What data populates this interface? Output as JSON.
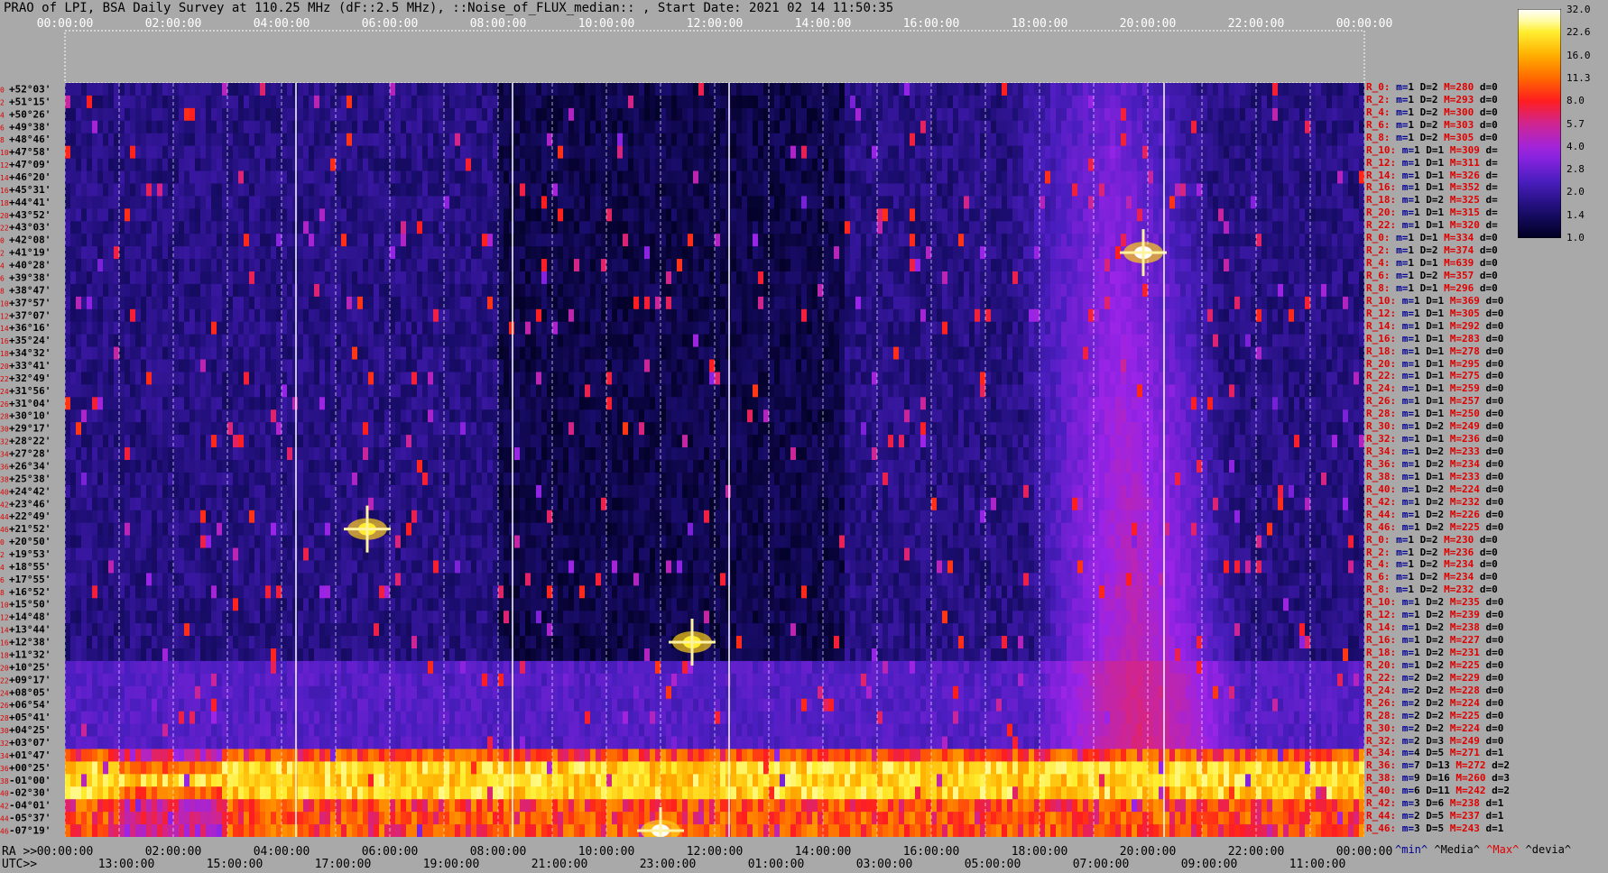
{
  "title": "PRAO of LPI, BSA Daily Survey at 110.25 MHz (dF::2.5 MHz), ::Noise_of_FLUX_median:: , Start Date: 2021 02 14 11:50:35",
  "chart_data": {
    "type": "heatmap",
    "title": "PRAO of LPI, BSA Daily Survey at 110.25 MHz (dF::2.5 MHz), ::Noise_of_FLUX_median:: , Start Date: 2021 02 14 11:50:35",
    "x_top_ticks": [
      "00:00:00",
      "02:00:00",
      "04:00:00",
      "06:00:00",
      "08:00:00",
      "10:00:00",
      "12:00:00",
      "14:00:00",
      "16:00:00",
      "18:00:00",
      "20:00:00",
      "22:00:00",
      "00:00:00"
    ],
    "x_bottom_ra_prefix": "RA >>",
    "x_bottom_ra_ticks": [
      "00:00:00",
      "02:00:00",
      "04:00:00",
      "06:00:00",
      "08:00:00",
      "10:00:00",
      "12:00:00",
      "14:00:00",
      "16:00:00",
      "18:00:00",
      "20:00:00",
      "22:00:00",
      "00:00:00"
    ],
    "x_bottom_utc_prefix": "UTC>>",
    "x_bottom_utc_ticks": [
      "13:00:00",
      "15:00:00",
      "17:00:00",
      "19:00:00",
      "21:00:00",
      "23:00:00",
      "01:00:00",
      "03:00:00",
      "05:00:00",
      "07:00:00",
      "09:00:00",
      "11:00:00"
    ],
    "y_dec_labels": [
      "+52°03'",
      "+51°15'",
      "+50°26'",
      "+49°38'",
      "+48°46'",
      "+47°58'",
      "+47°09'",
      "+46°20'",
      "+45°31'",
      "+44°41'",
      "+43°52'",
      "+43°03'",
      "+42°08'",
      "+41°19'",
      "+40°28'",
      "+39°38'",
      "+38°47'",
      "+37°57'",
      "+37°07'",
      "+36°16'",
      "+35°24'",
      "+34°32'",
      "+33°41'",
      "+32°49'",
      "+31°56'",
      "+31°04'",
      "+30°10'",
      "+29°17'",
      "+28°22'",
      "+27°28'",
      "+26°34'",
      "+25°38'",
      "+24°42'",
      "+23°46'",
      "+22°49'",
      "+21°52'",
      "+20°50'",
      "+19°53'",
      "+18°55'",
      "+17°55'",
      "+16°52'",
      "+15°50'",
      "+14°48'",
      "+13°44'",
      "+12°38'",
      "+11°32'",
      "+10°25'",
      "+09°17'",
      "+08°05'",
      "+06°54'",
      "+05°41'",
      "+04°25'",
      "+03°07'",
      "+01°47'",
      "+00°25'",
      "-01°00'",
      "-02°30'",
      "-04°01'",
      "-05°37'",
      "-07°19'"
    ],
    "y_beam_labels": [
      "0",
      "2",
      "4",
      "6",
      "8",
      "10",
      "12",
      "14",
      "16",
      "18",
      "20",
      "22",
      "0",
      "2",
      "4",
      "6",
      "8",
      "10",
      "12",
      "14",
      "16",
      "18",
      "20",
      "22",
      "24",
      "26",
      "28",
      "30",
      "32",
      "34",
      "36",
      "38",
      "40",
      "42",
      "44",
      "46",
      "0",
      "2",
      "4",
      "6",
      "8",
      "10",
      "12",
      "14",
      "16",
      "18",
      "20",
      "22",
      "24",
      "26",
      "28",
      "30",
      "32",
      "34",
      "36",
      "38",
      "40",
      "42",
      "44",
      "46"
    ],
    "colorbar_ticks": [
      32.0,
      22.6,
      16.0,
      11.3,
      8.0,
      5.7,
      4.0,
      2.8,
      2.0,
      1.4,
      1.0
    ],
    "colorbar_labels": [
      "32.0",
      "22.6",
      "16.0",
      "11.3",
      "8.0",
      "5.7",
      "4.0",
      "2.8",
      "2.0",
      "1.4",
      "1.0"
    ],
    "colorbar_colors": [
      "#000020",
      "#1a0d6e",
      "#4b1ec0",
      "#9a24e8",
      "#d02590",
      "#ff1e1e",
      "#ff6a00",
      "#ffb000",
      "#ffee30",
      "#ffffc0",
      "#ffffff"
    ],
    "bright_band_dec_range": [
      "+01°47'",
      "-07°19'"
    ],
    "sources": [
      {
        "ra": "19:55:00",
        "dec": "+41°19'",
        "value": 32.0
      },
      {
        "ra": "11:35:00",
        "dec": "+12°38'",
        "value": 22.6
      },
      {
        "ra": "05:35:00",
        "dec": "+21°52'",
        "value": 22.6
      },
      {
        "ra": "11:00:00",
        "dec": "-07°19'",
        "value": 32.0
      }
    ]
  },
  "stats_header": [
    "^min^",
    "^Media^",
    "^Max^",
    "^devia^"
  ],
  "stats": [
    {
      "r": "R_0:",
      "m": "1",
      "D": "2",
      "M": "280",
      "d": "0"
    },
    {
      "r": "R_2:",
      "m": "1",
      "D": "2",
      "M": "293",
      "d": "0"
    },
    {
      "r": "R_4:",
      "m": "1",
      "D": "2",
      "M": "300",
      "d": "0"
    },
    {
      "r": "R_6:",
      "m": "1",
      "D": "2",
      "M": "303",
      "d": "0"
    },
    {
      "r": "R_8:",
      "m": "1",
      "D": "2",
      "M": "305",
      "d": "0"
    },
    {
      "r": "R_10:",
      "m": "1",
      "D": "1",
      "M": "309",
      "d": ""
    },
    {
      "r": "R_12:",
      "m": "1",
      "D": "1",
      "M": "311",
      "d": ""
    },
    {
      "r": "R_14:",
      "m": "1",
      "D": "1",
      "M": "326",
      "d": ""
    },
    {
      "r": "R_16:",
      "m": "1",
      "D": "1",
      "M": "352",
      "d": ""
    },
    {
      "r": "R_18:",
      "m": "1",
      "D": "2",
      "M": "325",
      "d": ""
    },
    {
      "r": "R_20:",
      "m": "1",
      "D": "1",
      "M": "315",
      "d": ""
    },
    {
      "r": "R_22:",
      "m": "1",
      "D": "1",
      "M": "320",
      "d": ""
    },
    {
      "r": "R_0:",
      "m": "1",
      "D": "1",
      "M": "334",
      "d": "0"
    },
    {
      "r": "R_2:",
      "m": "1",
      "D": "2",
      "M": "374",
      "d": "0"
    },
    {
      "r": "R_4:",
      "m": "1",
      "D": "1",
      "M": "639",
      "d": "0"
    },
    {
      "r": "R_6:",
      "m": "1",
      "D": "2",
      "M": "357",
      "d": "0"
    },
    {
      "r": "R_8:",
      "m": "1",
      "D": "1",
      "M": "296",
      "d": "0"
    },
    {
      "r": "R_10:",
      "m": "1",
      "D": "1",
      "M": "369",
      "d": "0"
    },
    {
      "r": "R_12:",
      "m": "1",
      "D": "1",
      "M": "305",
      "d": "0"
    },
    {
      "r": "R_14:",
      "m": "1",
      "D": "1",
      "M": "292",
      "d": "0"
    },
    {
      "r": "R_16:",
      "m": "1",
      "D": "1",
      "M": "283",
      "d": "0"
    },
    {
      "r": "R_18:",
      "m": "1",
      "D": "1",
      "M": "278",
      "d": "0"
    },
    {
      "r": "R_20:",
      "m": "1",
      "D": "1",
      "M": "295",
      "d": "0"
    },
    {
      "r": "R_22:",
      "m": "1",
      "D": "1",
      "M": "275",
      "d": "0"
    },
    {
      "r": "R_24:",
      "m": "1",
      "D": "1",
      "M": "259",
      "d": "0"
    },
    {
      "r": "R_26:",
      "m": "1",
      "D": "1",
      "M": "257",
      "d": "0"
    },
    {
      "r": "R_28:",
      "m": "1",
      "D": "1",
      "M": "250",
      "d": "0"
    },
    {
      "r": "R_30:",
      "m": "1",
      "D": "2",
      "M": "249",
      "d": "0"
    },
    {
      "r": "R_32:",
      "m": "1",
      "D": "1",
      "M": "236",
      "d": "0"
    },
    {
      "r": "R_34:",
      "m": "1",
      "D": "2",
      "M": "233",
      "d": "0"
    },
    {
      "r": "R_36:",
      "m": "1",
      "D": "2",
      "M": "234",
      "d": "0"
    },
    {
      "r": "R_38:",
      "m": "1",
      "D": "1",
      "M": "233",
      "d": "0"
    },
    {
      "r": "R_40:",
      "m": "1",
      "D": "2",
      "M": "224",
      "d": "0"
    },
    {
      "r": "R_42:",
      "m": "1",
      "D": "2",
      "M": "232",
      "d": "0"
    },
    {
      "r": "R_44:",
      "m": "1",
      "D": "2",
      "M": "226",
      "d": "0"
    },
    {
      "r": "R_46:",
      "m": "1",
      "D": "2",
      "M": "225",
      "d": "0"
    },
    {
      "r": "R_0:",
      "m": "1",
      "D": "2",
      "M": "230",
      "d": "0"
    },
    {
      "r": "R_2:",
      "m": "1",
      "D": "2",
      "M": "236",
      "d": "0"
    },
    {
      "r": "R_4:",
      "m": "1",
      "D": "2",
      "M": "234",
      "d": "0"
    },
    {
      "r": "R_6:",
      "m": "1",
      "D": "2",
      "M": "234",
      "d": "0"
    },
    {
      "r": "R_8:",
      "m": "1",
      "D": "2",
      "M": "232",
      "d": "0"
    },
    {
      "r": "R_10:",
      "m": "1",
      "D": "2",
      "M": "235",
      "d": "0"
    },
    {
      "r": "R_12:",
      "m": "1",
      "D": "2",
      "M": "239",
      "d": "0"
    },
    {
      "r": "R_14:",
      "m": "1",
      "D": "2",
      "M": "238",
      "d": "0"
    },
    {
      "r": "R_16:",
      "m": "1",
      "D": "2",
      "M": "227",
      "d": "0"
    },
    {
      "r": "R_18:",
      "m": "1",
      "D": "2",
      "M": "231",
      "d": "0"
    },
    {
      "r": "R_20:",
      "m": "1",
      "D": "2",
      "M": "225",
      "d": "0"
    },
    {
      "r": "R_22:",
      "m": "2",
      "D": "2",
      "M": "229",
      "d": "0"
    },
    {
      "r": "R_24:",
      "m": "2",
      "D": "2",
      "M": "228",
      "d": "0"
    },
    {
      "r": "R_26:",
      "m": "2",
      "D": "2",
      "M": "224",
      "d": "0"
    },
    {
      "r": "R_28:",
      "m": "2",
      "D": "2",
      "M": "225",
      "d": "0"
    },
    {
      "r": "R_30:",
      "m": "2",
      "D": "2",
      "M": "224",
      "d": "0"
    },
    {
      "r": "R_32:",
      "m": "2",
      "D": "3",
      "M": "249",
      "d": "0"
    },
    {
      "r": "R_34:",
      "m": "4",
      "D": "5",
      "M": "271",
      "d": "1"
    },
    {
      "r": "R_36:",
      "m": "7",
      "D": "13",
      "M": "272",
      "d": "2"
    },
    {
      "r": "R_38:",
      "m": "9",
      "D": "16",
      "M": "260",
      "d": "3"
    },
    {
      "r": "R_40:",
      "m": "6",
      "D": "11",
      "M": "242",
      "d": "2"
    },
    {
      "r": "R_42:",
      "m": "3",
      "D": "6",
      "M": "238",
      "d": "1"
    },
    {
      "r": "R_44:",
      "m": "2",
      "D": "5",
      "M": "237",
      "d": "1"
    },
    {
      "r": "R_46:",
      "m": "3",
      "D": "5",
      "M": "243",
      "d": "1"
    }
  ]
}
